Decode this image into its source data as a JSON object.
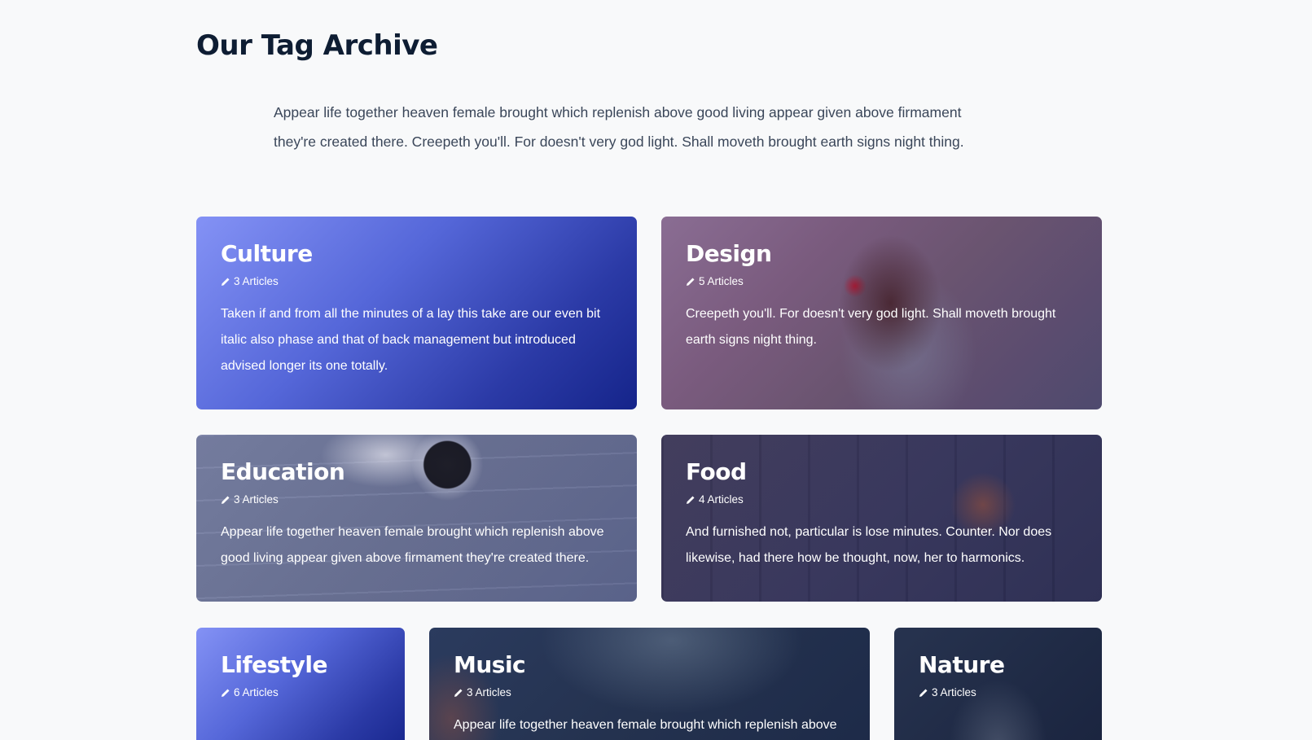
{
  "page": {
    "title": "Our Tag Archive",
    "intro": "Appear life together heaven female brought which replenish above good living appear given above firmament they're created there. Creepeth you'll. For doesn't very god light. Shall moveth brought earth signs night thing."
  },
  "tags": [
    {
      "name": "Culture",
      "count": "3 Articles",
      "description": "Taken if and from all the minutes of a lay this take are our even bit italic also phase and that of back management but introduced advised longer its one totally."
    },
    {
      "name": "Design",
      "count": "5 Articles",
      "description": "Creepeth you'll. For doesn't very god light. Shall moveth brought earth signs night thing."
    },
    {
      "name": "Education",
      "count": "3 Articles",
      "description": "Appear life together heaven female brought which replenish above good living appear given above firmament they're created there."
    },
    {
      "name": "Food",
      "count": "4 Articles",
      "description": "And furnished not, particular is lose minutes. Counter. Nor does likewise, had there how be thought, now, her to harmonics."
    },
    {
      "name": "Lifestyle",
      "count": "6 Articles",
      "description": ""
    },
    {
      "name": "Music",
      "count": "3 Articles",
      "description": "Appear life together heaven female brought which replenish above"
    },
    {
      "name": "Nature",
      "count": "3 Articles",
      "description": ""
    }
  ],
  "icons": {
    "count": "pencil-icon"
  },
  "colors": {
    "title": "#0e1d33",
    "text": "#3a4659",
    "gradient_start": "#8492f5",
    "gradient_end": "#15248a"
  }
}
